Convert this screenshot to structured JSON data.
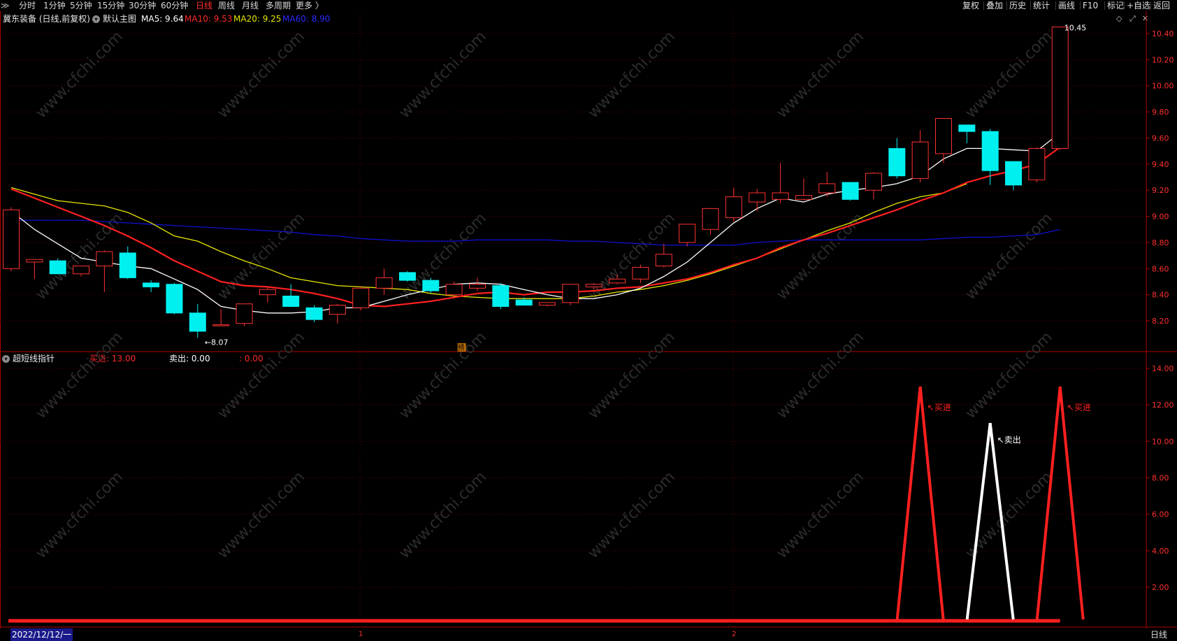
{
  "topbar": {
    "menu_glyph": "≫",
    "periods": [
      {
        "label": "分时",
        "active": false
      },
      {
        "label": "1分钟",
        "active": false
      },
      {
        "label": "5分钟",
        "active": false
      },
      {
        "label": "15分钟",
        "active": false
      },
      {
        "label": "30分钟",
        "active": false
      },
      {
        "label": "60分钟",
        "active": false
      },
      {
        "label": "日线",
        "active": true
      },
      {
        "label": "周线",
        "active": false
      },
      {
        "label": "月线",
        "active": false
      },
      {
        "label": "多周期",
        "active": false
      },
      {
        "label": "更多 〉",
        "active": false
      }
    ],
    "tools": [
      "复权",
      "叠加",
      "历史",
      "统计",
      "画线",
      "F10",
      "标记",
      "+自选",
      "返回"
    ]
  },
  "main_header": {
    "stock": "冀东装备 (日线,前复权)",
    "template": "默认主图",
    "ma5": "MA5: 9.64",
    "ma10": "MA10: 9.53",
    "ma20": "MA20: 9.25",
    "ma60": "MA60: 8.90",
    "icons": [
      "diamond-icon",
      "expand-icon",
      "close-icon"
    ]
  },
  "sub_header": {
    "name": "超短线指针",
    "buy": "买进: 13.00",
    "sell": "卖出: 0.00",
    "third": ": 0.00"
  },
  "colors": {
    "up": "#ff3232",
    "down": "#00f0f0",
    "ma5": "#ffffff",
    "ma10": "#ff2020",
    "ma20": "#e6e600",
    "ma60": "#1010d0",
    "axis": "#b00000"
  },
  "chart_data": [
    {
      "type": "candlestick",
      "axis_ticks": [
        "10.40",
        "10.20",
        "10.00",
        "9.80",
        "9.60",
        "9.40",
        "9.20",
        "9.00",
        "8.80",
        "8.60",
        "8.40",
        "8.20"
      ],
      "ylim": [
        8.07,
        10.45
      ],
      "annotations": {
        "max_label": "10.45",
        "min_label": "←8.07",
        "marker": "预"
      },
      "candles": [
        {
          "o": 8.6,
          "h": 9.07,
          "l": 8.58,
          "c": 9.05
        },
        {
          "o": 8.65,
          "h": 8.66,
          "l": 8.52,
          "c": 8.67
        },
        {
          "o": 8.66,
          "h": 8.68,
          "l": 8.56,
          "c": 8.56
        },
        {
          "o": 8.56,
          "h": 8.62,
          "l": 8.54,
          "c": 8.62
        },
        {
          "o": 8.62,
          "h": 8.74,
          "l": 8.42,
          "c": 8.73
        },
        {
          "o": 8.72,
          "h": 8.77,
          "l": 8.52,
          "c": 8.53
        },
        {
          "o": 8.49,
          "h": 8.51,
          "l": 8.42,
          "c": 8.46
        },
        {
          "o": 8.48,
          "h": 8.49,
          "l": 8.25,
          "c": 8.26
        },
        {
          "o": 8.26,
          "h": 8.33,
          "l": 8.07,
          "c": 8.12
        },
        {
          "o": 8.17,
          "h": 8.29,
          "l": 8.16,
          "c": 8.17
        },
        {
          "o": 8.18,
          "h": 8.33,
          "l": 8.16,
          "c": 8.33
        },
        {
          "o": 8.4,
          "h": 8.46,
          "l": 8.34,
          "c": 8.44
        },
        {
          "o": 8.39,
          "h": 8.48,
          "l": 8.31,
          "c": 8.31
        },
        {
          "o": 8.3,
          "h": 8.32,
          "l": 8.19,
          "c": 8.21
        },
        {
          "o": 8.25,
          "h": 8.33,
          "l": 8.18,
          "c": 8.32
        },
        {
          "o": 8.3,
          "h": 8.46,
          "l": 8.28,
          "c": 8.45
        },
        {
          "o": 8.45,
          "h": 8.6,
          "l": 8.4,
          "c": 8.53
        },
        {
          "o": 8.57,
          "h": 8.58,
          "l": 8.5,
          "c": 8.51
        },
        {
          "o": 8.51,
          "h": 8.53,
          "l": 8.41,
          "c": 8.43
        },
        {
          "o": 8.4,
          "h": 8.5,
          "l": 8.37,
          "c": 8.48
        },
        {
          "o": 8.45,
          "h": 8.53,
          "l": 8.43,
          "c": 8.48
        },
        {
          "o": 8.47,
          "h": 8.49,
          "l": 8.29,
          "c": 8.31
        },
        {
          "o": 8.36,
          "h": 8.38,
          "l": 8.32,
          "c": 8.32
        },
        {
          "o": 8.32,
          "h": 8.34,
          "l": 8.31,
          "c": 8.34
        },
        {
          "o": 8.34,
          "h": 8.46,
          "l": 8.32,
          "c": 8.48
        },
        {
          "o": 8.46,
          "h": 8.49,
          "l": 8.44,
          "c": 8.48
        },
        {
          "o": 8.49,
          "h": 8.55,
          "l": 8.48,
          "c": 8.52
        },
        {
          "o": 8.52,
          "h": 8.63,
          "l": 8.49,
          "c": 8.61
        },
        {
          "o": 8.62,
          "h": 8.79,
          "l": 8.61,
          "c": 8.71
        },
        {
          "o": 8.8,
          "h": 8.91,
          "l": 8.77,
          "c": 8.94
        },
        {
          "o": 8.9,
          "h": 9.06,
          "l": 8.86,
          "c": 9.06
        },
        {
          "o": 8.99,
          "h": 9.22,
          "l": 8.96,
          "c": 9.15
        },
        {
          "o": 9.11,
          "h": 9.21,
          "l": 9.04,
          "c": 9.18
        },
        {
          "o": 9.13,
          "h": 9.41,
          "l": 9.1,
          "c": 9.18
        },
        {
          "o": 9.13,
          "h": 9.29,
          "l": 9.12,
          "c": 9.16
        },
        {
          "o": 9.18,
          "h": 9.34,
          "l": 9.15,
          "c": 9.25
        },
        {
          "o": 9.26,
          "h": 9.26,
          "l": 9.12,
          "c": 9.13
        },
        {
          "o": 9.2,
          "h": 9.34,
          "l": 9.13,
          "c": 9.33
        },
        {
          "o": 9.52,
          "h": 9.6,
          "l": 9.29,
          "c": 9.31
        },
        {
          "o": 9.29,
          "h": 9.66,
          "l": 9.26,
          "c": 9.57
        },
        {
          "o": 9.48,
          "h": 9.75,
          "l": 9.41,
          "c": 9.75
        },
        {
          "o": 9.7,
          "h": 9.7,
          "l": 9.56,
          "c": 9.65
        },
        {
          "o": 9.65,
          "h": 9.67,
          "l": 9.24,
          "c": 9.35
        },
        {
          "o": 9.42,
          "h": 9.42,
          "l": 9.2,
          "c": 9.24
        },
        {
          "o": 9.28,
          "h": 9.53,
          "l": 9.26,
          "c": 9.52
        },
        {
          "o": 9.52,
          "h": 10.45,
          "l": 9.51,
          "c": 10.45
        }
      ],
      "ma5": [
        9.04,
        8.9,
        8.79,
        8.68,
        8.65,
        8.62,
        8.6,
        8.52,
        8.44,
        8.31,
        8.28,
        8.26,
        8.26,
        8.27,
        8.3,
        8.3,
        8.35,
        8.4,
        8.44,
        8.48,
        8.49,
        8.48,
        8.44,
        8.4,
        8.37,
        8.37,
        8.4,
        8.45,
        8.54,
        8.65,
        8.8,
        8.95,
        9.06,
        9.14,
        9.11,
        9.17,
        9.2,
        9.22,
        9.25,
        9.31,
        9.44,
        9.52,
        9.52,
        9.51,
        9.5,
        9.64
      ],
      "ma10": [
        9.21,
        9.14,
        9.07,
        9.0,
        8.93,
        8.85,
        8.76,
        8.66,
        8.58,
        8.5,
        8.47,
        8.46,
        8.44,
        8.41,
        8.37,
        8.32,
        8.31,
        8.33,
        8.35,
        8.38,
        8.41,
        8.42,
        8.4,
        8.42,
        8.42,
        8.43,
        8.45,
        8.46,
        8.49,
        8.52,
        8.57,
        8.63,
        8.68,
        8.76,
        8.82,
        8.87,
        8.93,
        8.99,
        9.05,
        9.12,
        9.18,
        9.26,
        9.31,
        9.35,
        9.4,
        9.53
      ],
      "ma20": [
        9.22,
        9.17,
        9.12,
        9.1,
        9.08,
        9.03,
        8.95,
        8.85,
        8.81,
        8.73,
        8.66,
        8.6,
        8.53,
        8.5,
        8.47,
        8.46,
        8.45,
        8.44,
        8.41,
        8.39,
        8.38,
        8.37,
        8.37,
        8.37,
        8.37,
        8.39,
        8.42,
        8.44,
        8.47,
        8.51,
        8.56,
        8.62,
        8.68,
        8.75,
        8.82,
        8.89,
        8.95,
        9.03,
        9.1,
        9.15,
        9.18,
        9.25
      ],
      "ma20_start": 0,
      "ma60": [
        8.97,
        8.97,
        8.97,
        8.97,
        8.96,
        8.95,
        8.94,
        8.93,
        8.92,
        8.91,
        8.9,
        8.89,
        8.88,
        8.86,
        8.85,
        8.83,
        8.82,
        8.81,
        8.81,
        8.81,
        8.82,
        8.82,
        8.82,
        8.82,
        8.81,
        8.81,
        8.8,
        8.79,
        8.78,
        8.78,
        8.78,
        8.78,
        8.8,
        8.81,
        8.82,
        8.82,
        8.82,
        8.82,
        8.82,
        8.82,
        8.83,
        8.84,
        8.84,
        8.85,
        8.86,
        8.9
      ]
    },
    {
      "type": "line",
      "name": "超短线指针",
      "axis_ticks": [
        "14.00",
        "12.00",
        "10.00",
        "8.00",
        "6.00",
        "4.00",
        "2.00"
      ],
      "ylim": [
        0,
        14
      ],
      "signals": [
        {
          "label": "买进",
          "peak_index": 39,
          "value": 13.0,
          "color": "#ff2020"
        },
        {
          "label": "卖出",
          "peak_index": 42,
          "value": 11.0,
          "color": "#ffffff"
        },
        {
          "label": "买进",
          "peak_index": 45,
          "value": 13.0,
          "color": "#ff2020"
        }
      ],
      "signal_labels": [
        "↖买进",
        "↖卖出",
        "↖买进"
      ]
    }
  ],
  "bottom": {
    "date": "2022/12/12/一",
    "marker1": "1",
    "marker2": "2",
    "axis_label": "日线"
  },
  "watermark": "www.cfchi.com"
}
